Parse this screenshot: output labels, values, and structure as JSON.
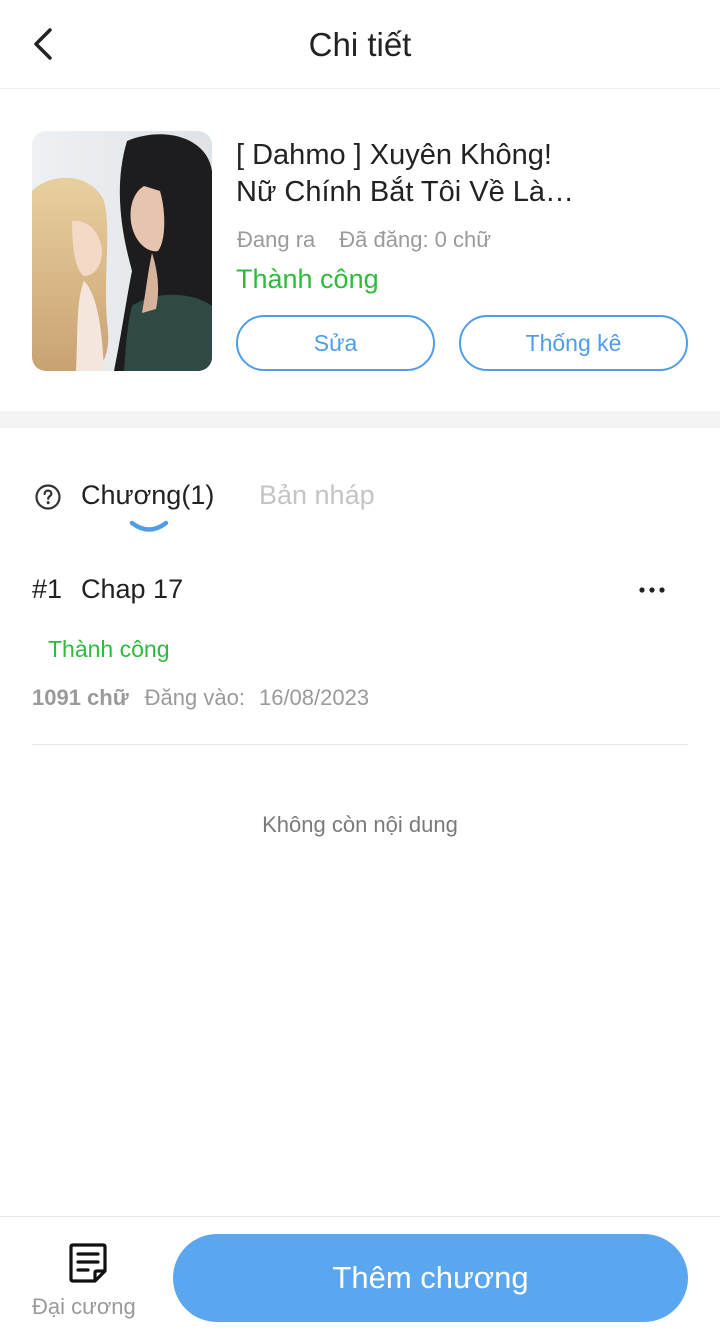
{
  "header": {
    "title": "Chi tiết",
    "back_icon": "chevron-left-icon"
  },
  "story": {
    "title_line1": "[ Dahmo ] Xuyên Không!",
    "title_line2": "Nữ Chính Bắt Tôi Về Là…",
    "state": "Đang ra",
    "word_count": "Đã đăng: 0 chữ",
    "status": "Thành công",
    "status_color": "#2dbb3b",
    "edit_label": "Sửa",
    "stats_label": "Thống kê"
  },
  "tabs": {
    "help_icon": "question-circle-icon",
    "chapters_label": "Chương(1)",
    "drafts_label": "Bản nháp"
  },
  "chapters": [
    {
      "number": "#1",
      "title": "Chap 17",
      "status": "Thành công",
      "words": "1091 chữ",
      "date_label": "Đăng vào:",
      "date": "16/08/2023"
    }
  ],
  "empty_text": "Không còn nội dung",
  "bottom": {
    "outline_label": "Đại cương",
    "outline_icon": "document-icon",
    "add_chapter_label": "Thêm chương",
    "accent_color": "#5aa6ef"
  }
}
